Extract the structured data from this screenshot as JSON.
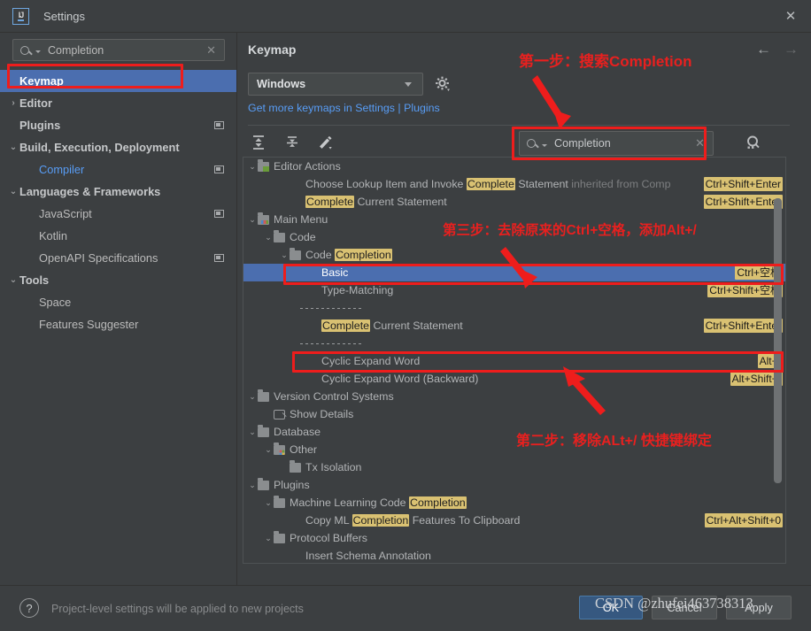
{
  "window": {
    "title": "Settings",
    "logo_text": "IJ",
    "close_icon": "✕"
  },
  "sidebar": {
    "search": {
      "value": "Completion",
      "placeholder": "Search settings",
      "clear_icon": "✕"
    },
    "items": [
      {
        "label": "Keymap",
        "selected": true,
        "chev": "",
        "indent": 0,
        "badge": false,
        "link": false,
        "bold": true
      },
      {
        "label": "Editor",
        "selected": false,
        "chev": "›",
        "indent": 0,
        "badge": false,
        "link": false,
        "bold": true
      },
      {
        "label": "Plugins",
        "selected": false,
        "chev": "",
        "indent": 0,
        "badge": true,
        "link": false,
        "bold": true
      },
      {
        "label": "Build, Execution, Deployment",
        "selected": false,
        "chev": "⌄",
        "indent": 0,
        "badge": false,
        "link": false,
        "bold": true
      },
      {
        "label": "Compiler",
        "selected": false,
        "chev": "",
        "indent": 1,
        "badge": true,
        "link": true,
        "bold": false
      },
      {
        "label": "Languages & Frameworks",
        "selected": false,
        "chev": "⌄",
        "indent": 0,
        "badge": false,
        "link": false,
        "bold": true
      },
      {
        "label": "JavaScript",
        "selected": false,
        "chev": "",
        "indent": 1,
        "badge": true,
        "link": false,
        "bold": false
      },
      {
        "label": "Kotlin",
        "selected": false,
        "chev": "",
        "indent": 1,
        "badge": false,
        "link": false,
        "bold": false
      },
      {
        "label": "OpenAPI Specifications",
        "selected": false,
        "chev": "",
        "indent": 1,
        "badge": true,
        "link": false,
        "bold": false
      },
      {
        "label": "Tools",
        "selected": false,
        "chev": "⌄",
        "indent": 0,
        "badge": false,
        "link": false,
        "bold": true
      },
      {
        "label": "Space",
        "selected": false,
        "chev": "",
        "indent": 1,
        "badge": false,
        "link": false,
        "bold": false
      },
      {
        "label": "Features Suggester",
        "selected": false,
        "chev": "",
        "indent": 1,
        "badge": false,
        "link": false,
        "bold": false
      }
    ]
  },
  "panel": {
    "title": "Keymap",
    "back_icon": "←",
    "forward_icon": "→",
    "keymap_selected": "Windows",
    "gear_icon": "gear-icon",
    "plugins_link": "Get more keymaps in Settings | Plugins",
    "toolbar": {
      "expand_all": "expand-all-icon",
      "collapse_all": "collapse-all-icon",
      "edit_shortcut": "edit-shortcut-icon"
    },
    "search": {
      "value": "Completion",
      "placeholder": "Search by name",
      "clear_icon": "✕"
    },
    "find_by_shortcut": "find-by-shortcut-icon"
  },
  "tree": [
    {
      "id": "editor-actions",
      "indent": 0,
      "chev": "⌄",
      "icon": "folder-green",
      "parts": [
        {
          "t": "Editor Actions",
          "s": "plain"
        }
      ],
      "shortcut": "",
      "selected": false
    },
    {
      "id": "choose-lookup-item",
      "indent": 3,
      "chev": "",
      "icon": "none",
      "parts": [
        {
          "t": "Choose Lookup Item and Invoke ",
          "s": "plain"
        },
        {
          "t": "Complete",
          "s": "hl"
        },
        {
          "t": " Statement ",
          "s": "plain"
        },
        {
          "t": "inherited from ",
          "s": "muted"
        },
        {
          "t": "Comp",
          "s": "muted-link"
        }
      ],
      "shortcut": "Ctrl+Shift+Enter",
      "selected": false
    },
    {
      "id": "complete-current-statement-1",
      "indent": 3,
      "chev": "",
      "icon": "none",
      "parts": [
        {
          "t": "Complete",
          "s": "hl"
        },
        {
          "t": " Current Statement",
          "s": "plain"
        }
      ],
      "shortcut": "Ctrl+Shift+Enter",
      "selected": false
    },
    {
      "id": "main-menu",
      "indent": 0,
      "chev": "⌄",
      "icon": "folder-menu",
      "parts": [
        {
          "t": "Main Menu",
          "s": "plain"
        }
      ],
      "shortcut": "",
      "selected": false
    },
    {
      "id": "code",
      "indent": 1,
      "chev": "⌄",
      "icon": "folder",
      "parts": [
        {
          "t": "Code",
          "s": "plain"
        }
      ],
      "shortcut": "",
      "selected": false
    },
    {
      "id": "code-completion",
      "indent": 2,
      "chev": "⌄",
      "icon": "folder",
      "parts": [
        {
          "t": "Code ",
          "s": "plain"
        },
        {
          "t": "Completion",
          "s": "hl"
        }
      ],
      "shortcut": "",
      "selected": false
    },
    {
      "id": "basic",
      "indent": 4,
      "chev": "",
      "icon": "none",
      "parts": [
        {
          "t": "Basic",
          "s": "plain"
        }
      ],
      "shortcut": "Ctrl+空格",
      "selected": true
    },
    {
      "id": "type-matching",
      "indent": 4,
      "chev": "",
      "icon": "none",
      "parts": [
        {
          "t": "Type-Matching",
          "s": "plain"
        }
      ],
      "shortcut": "Ctrl+Shift+空格",
      "selected": false
    },
    {
      "id": "separator-1",
      "indent": 4,
      "chev": "",
      "icon": "separator",
      "parts": [],
      "shortcut": "",
      "selected": false
    },
    {
      "id": "complete-current-statement-2",
      "indent": 4,
      "chev": "",
      "icon": "none",
      "parts": [
        {
          "t": "Complete",
          "s": "hl"
        },
        {
          "t": " Current Statement",
          "s": "plain"
        }
      ],
      "shortcut": "Ctrl+Shift+Enter",
      "selected": false
    },
    {
      "id": "separator-2",
      "indent": 4,
      "chev": "",
      "icon": "separator",
      "parts": [],
      "shortcut": "",
      "selected": false
    },
    {
      "id": "cyclic-expand-word",
      "indent": 4,
      "chev": "",
      "icon": "none",
      "parts": [
        {
          "t": "Cyclic Expand Word",
          "s": "plain"
        }
      ],
      "shortcut": "Alt+/",
      "selected": false
    },
    {
      "id": "cyclic-expand-word-backward",
      "indent": 4,
      "chev": "",
      "icon": "none",
      "parts": [
        {
          "t": "Cyclic Expand Word (Backward)",
          "s": "plain"
        }
      ],
      "shortcut": "Alt+Shift+/",
      "selected": false
    },
    {
      "id": "version-control-systems",
      "indent": 0,
      "chev": "⌄",
      "icon": "folder",
      "parts": [
        {
          "t": "Version Control Systems",
          "s": "plain"
        }
      ],
      "shortcut": "",
      "selected": false
    },
    {
      "id": "show-details",
      "indent": 1,
      "chev": "",
      "icon": "vcs",
      "parts": [
        {
          "t": "Show Details",
          "s": "plain"
        }
      ],
      "shortcut": "",
      "selected": false
    },
    {
      "id": "database",
      "indent": 0,
      "chev": "⌄",
      "icon": "folder",
      "parts": [
        {
          "t": "Database",
          "s": "plain"
        }
      ],
      "shortcut": "",
      "selected": false
    },
    {
      "id": "other",
      "indent": 1,
      "chev": "⌄",
      "icon": "folder-dots",
      "parts": [
        {
          "t": "Other",
          "s": "plain"
        }
      ],
      "shortcut": "",
      "selected": false
    },
    {
      "id": "tx-isolation",
      "indent": 2,
      "chev": "",
      "icon": "folder",
      "parts": [
        {
          "t": "Tx Isolation",
          "s": "plain"
        }
      ],
      "shortcut": "",
      "selected": false
    },
    {
      "id": "plugins",
      "indent": 0,
      "chev": "⌄",
      "icon": "folder",
      "parts": [
        {
          "t": "Plugins",
          "s": "plain"
        }
      ],
      "shortcut": "",
      "selected": false
    },
    {
      "id": "ml-code-completion",
      "indent": 1,
      "chev": "⌄",
      "icon": "folder",
      "parts": [
        {
          "t": "Machine Learning Code ",
          "s": "plain"
        },
        {
          "t": "Completion",
          "s": "hl"
        }
      ],
      "shortcut": "",
      "selected": false
    },
    {
      "id": "copy-ml-completion-features",
      "indent": 3,
      "chev": "",
      "icon": "none",
      "parts": [
        {
          "t": "Copy ML ",
          "s": "plain"
        },
        {
          "t": "Completion",
          "s": "hl"
        },
        {
          "t": " Features To Clipboard",
          "s": "plain"
        }
      ],
      "shortcut": "Ctrl+Alt+Shift+0",
      "selected": false
    },
    {
      "id": "protocol-buffers",
      "indent": 1,
      "chev": "⌄",
      "icon": "folder",
      "parts": [
        {
          "t": "Protocol Buffers",
          "s": "plain"
        }
      ],
      "shortcut": "",
      "selected": false
    },
    {
      "id": "insert-schema-annotation",
      "indent": 3,
      "chev": "",
      "icon": "none",
      "parts": [
        {
          "t": "Insert Schema Annotation",
          "s": "plain"
        }
      ],
      "shortcut": "",
      "selected": false
    }
  ],
  "footer": {
    "help_icon": "?",
    "note": "Project-level settings will be applied to new projects",
    "ok": "OK",
    "cancel": "Cancel",
    "apply": "Apply"
  },
  "watermark": "CSDN @zhufei463738313",
  "annotations": {
    "step1": "第一步：搜索Completion",
    "step2": "第二步：移除ALt+/ 快捷键绑定",
    "step3": "第三步：去除原来的Ctrl+空格，添加Alt+/",
    "color": "#ee1d1c"
  }
}
